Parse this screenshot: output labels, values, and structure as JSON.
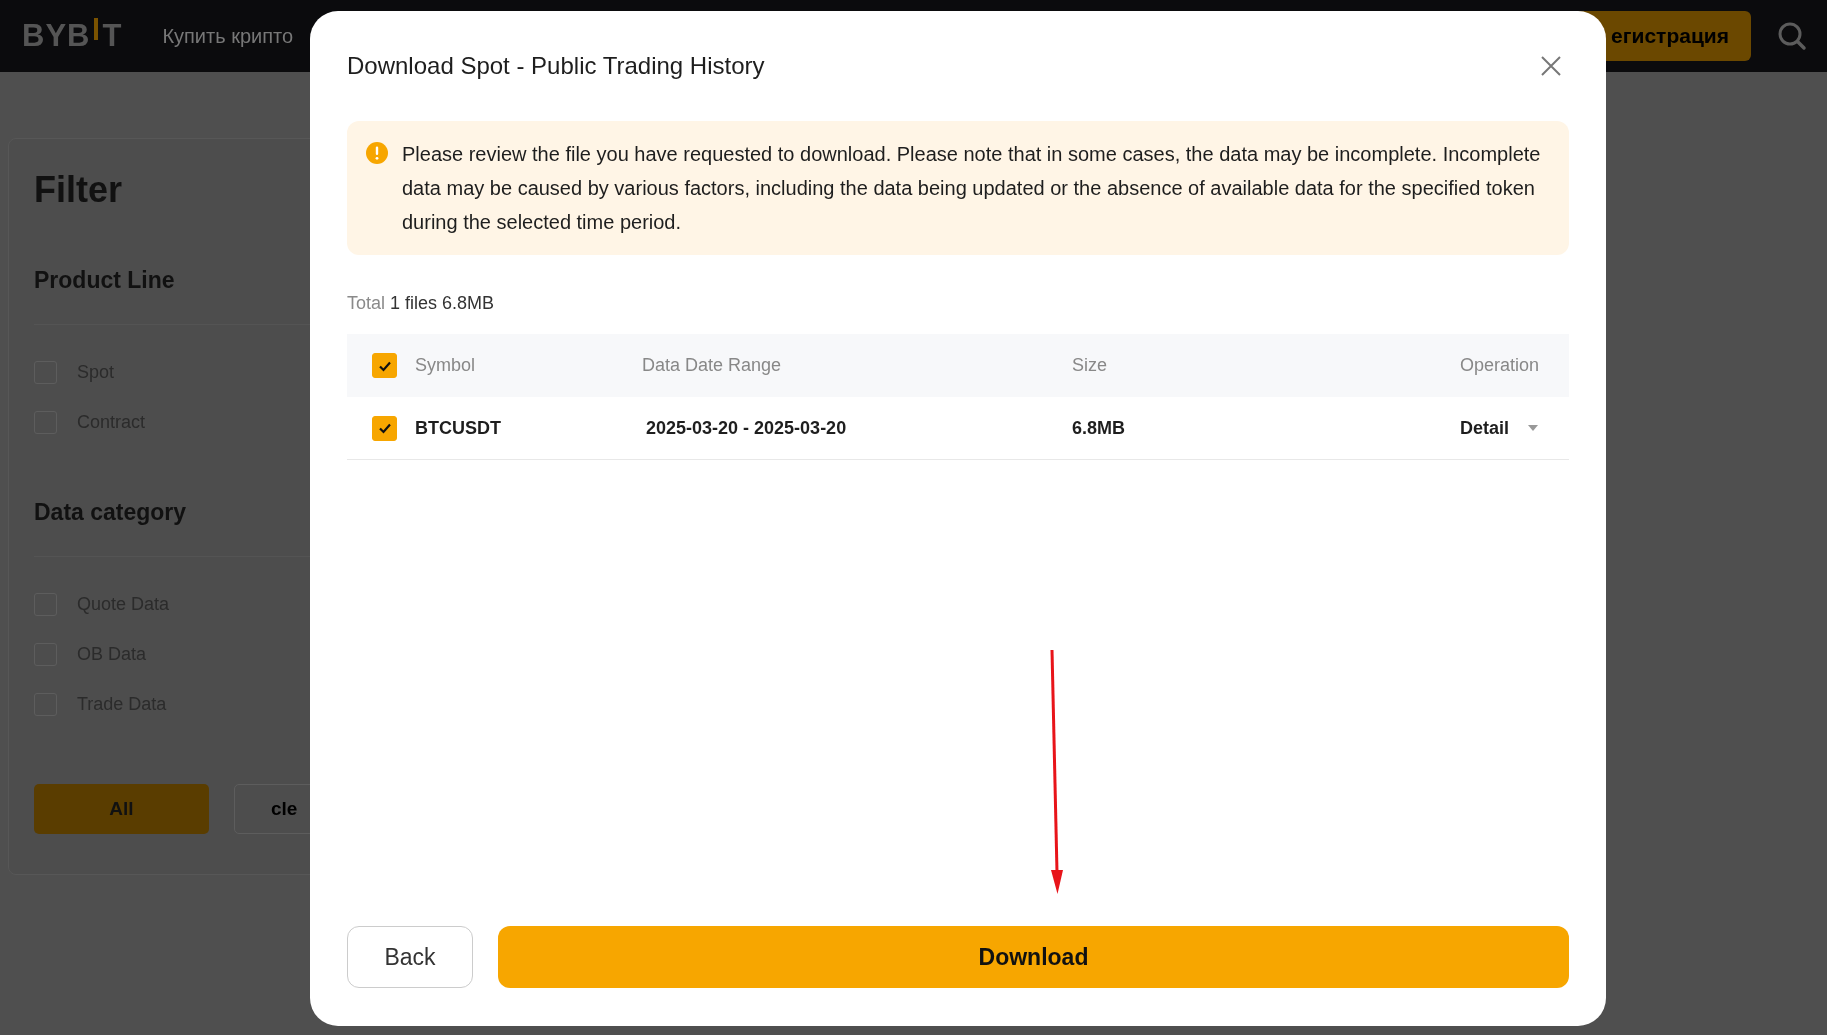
{
  "topbar": {
    "logo": {
      "before": "BYB",
      "after": "T"
    },
    "nav_item": "Купить крипто",
    "register_button": "егистрация"
  },
  "filter": {
    "title": "Filter",
    "sections": [
      {
        "title": "Product Line",
        "items": [
          {
            "label": "Spot",
            "checked": false
          },
          {
            "label": "Contract",
            "checked": false
          }
        ]
      },
      {
        "title": "Data category",
        "items": [
          {
            "label": "Quote Data",
            "checked": false
          },
          {
            "label": "OB Data",
            "checked": false
          },
          {
            "label": "Trade Data",
            "checked": false
          }
        ]
      }
    ],
    "buttons": [
      {
        "label": "All",
        "kind": "primary"
      },
      {
        "label": "cle",
        "kind": "secondary"
      }
    ]
  },
  "dialog": {
    "title": "Download Spot - Public Trading History",
    "notice": "Please review the file you have requested to download. Please note that in some cases, the data may be incomplete. Incomplete data may be caused by various factors, including the data being updated or the absence of available data for the specified token during the selected time period.",
    "total_label": "Total",
    "total_value": "1 files 6.8MB",
    "table": {
      "all_checked": true,
      "columns": [
        "Symbol",
        "Data Date Range",
        "Size",
        "Operation"
      ],
      "rows": [
        {
          "checked": true,
          "symbol": "BTCUSDT",
          "date_range": "2025-03-20 - 2025-03-20",
          "size": "6.8MB",
          "operation": "Detail"
        }
      ]
    },
    "buttons": [
      {
        "label": "Back",
        "kind": "secondary"
      },
      {
        "label": "Download",
        "kind": "primary"
      }
    ]
  }
}
